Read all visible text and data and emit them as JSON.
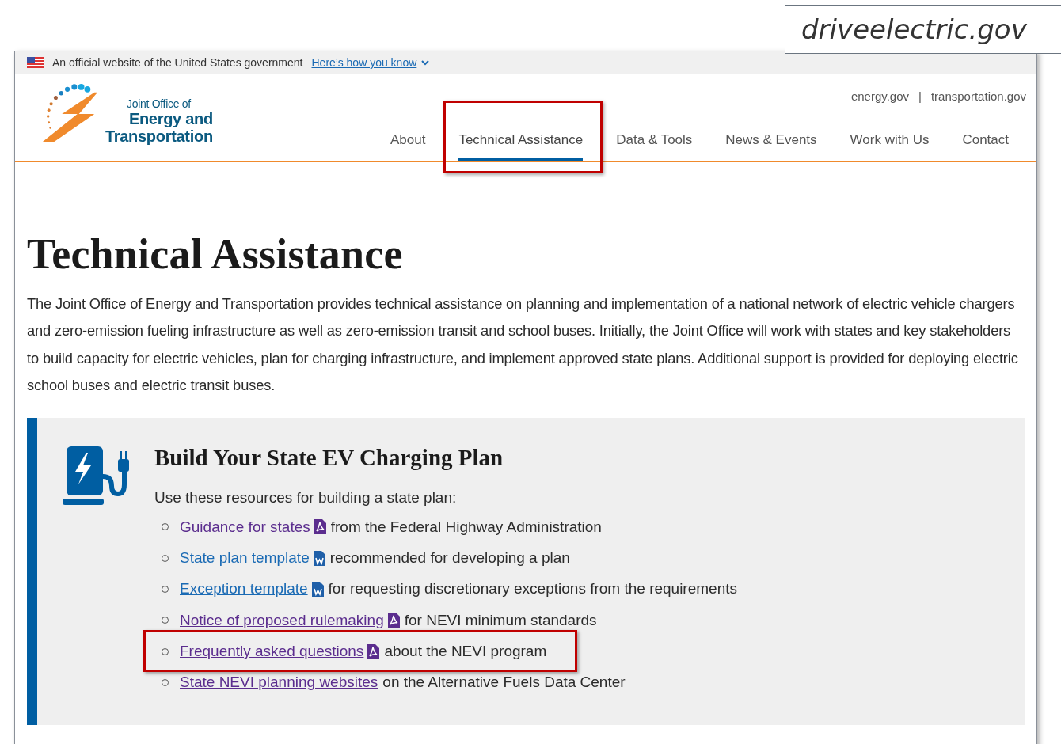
{
  "caption": "driveelectric.gov",
  "gov_banner": {
    "text": "An official website of the United States government",
    "link": "Here’s how you know"
  },
  "logo": {
    "line_1": "Joint Office of",
    "line_2": "Energy and",
    "line_3": "Transportation"
  },
  "utility_links": [
    "energy.gov",
    "transportation.gov"
  ],
  "utility_separator": "|",
  "nav": [
    {
      "label": "About",
      "selected": false,
      "highlighted": false
    },
    {
      "label": "Technical Assistance",
      "selected": true,
      "highlighted": true
    },
    {
      "label": "Data & Tools",
      "selected": false,
      "highlighted": false
    },
    {
      "label": "News & Events",
      "selected": false,
      "highlighted": false
    },
    {
      "label": "Work with Us",
      "selected": false,
      "highlighted": false
    },
    {
      "label": "Contact",
      "selected": false,
      "highlighted": false
    }
  ],
  "page_title": "Technical Assistance",
  "intro": "The Joint Office of Energy and Transportation provides technical assistance on planning and implementation of a national network of electric vehicle chargers and zero-emission fueling infrastructure as well as zero-emission transit and school buses. Initially, the Joint Office will work with states and key stakeholders to build capacity for electric vehicles, plan for charging infrastructure, and implement approved state plans. Additional support is provided for deploying electric school buses and electric transit buses.",
  "callout": {
    "title": "Build Your State EV Charging Plan",
    "lead": "Use these resources for building a state plan:",
    "items": [
      {
        "link": "Guidance for states",
        "visited": true,
        "kind": "pdf",
        "text": "from the Federal Highway Administration",
        "highlighted": false
      },
      {
        "link": "State plan template",
        "visited": false,
        "kind": "word",
        "text": "recommended for developing a plan",
        "highlighted": false
      },
      {
        "link": "Exception template",
        "visited": false,
        "kind": "word",
        "text": "for requesting discretionary exceptions from the requirements",
        "highlighted": false
      },
      {
        "link": "Notice of proposed rulemaking",
        "visited": true,
        "kind": "pdf",
        "text": "for NEVI minimum standards",
        "highlighted": false
      },
      {
        "link": "Frequently asked questions",
        "visited": true,
        "kind": "pdf",
        "text": "about the NEVI program",
        "highlighted": true
      },
      {
        "link": "State NEVI planning websites",
        "visited": true,
        "kind": "plain",
        "text": "on the Alternative Fuels Data Center",
        "highlighted": false
      }
    ]
  }
}
